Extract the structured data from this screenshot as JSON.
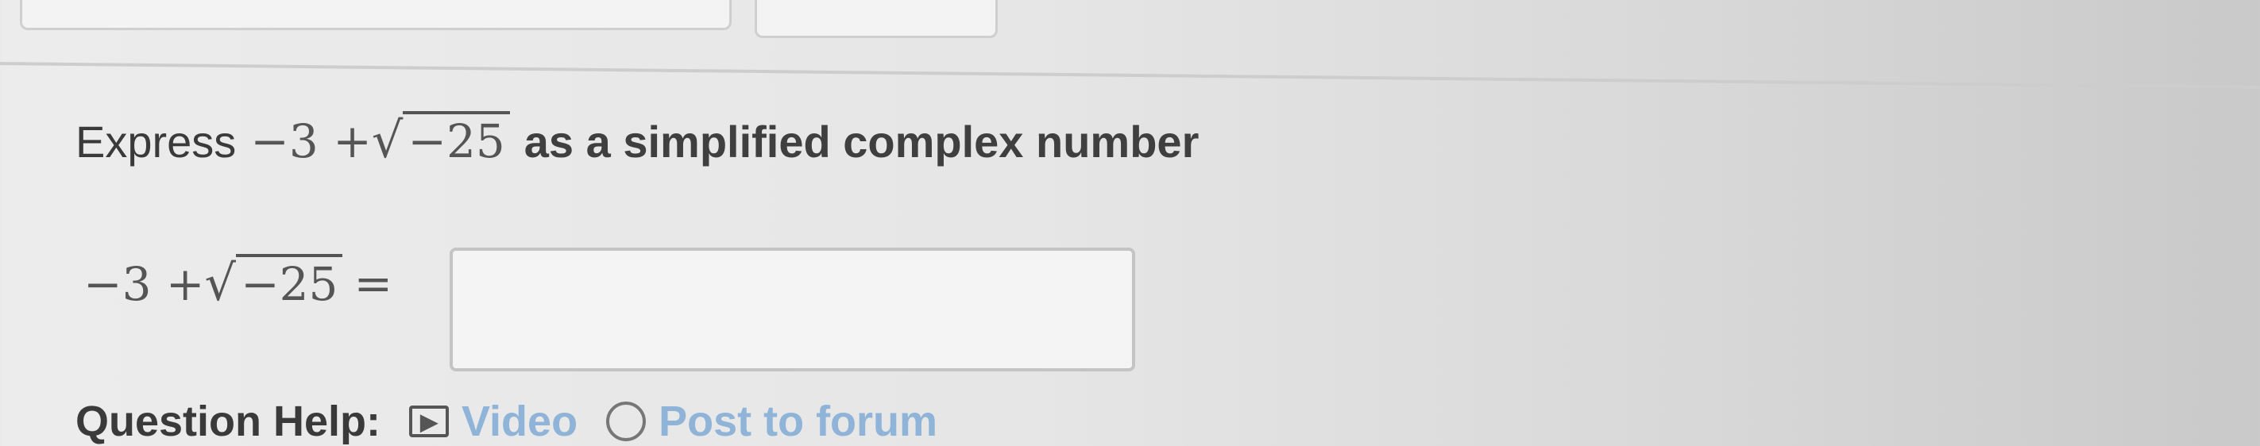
{
  "question": {
    "prefix": "Express",
    "expression": {
      "lead": "−3 + ",
      "radicand": "−25"
    },
    "suffix": "as a simplified complex number"
  },
  "answer_row": {
    "expression": {
      "lead": "−3 + ",
      "radicand": "−25"
    },
    "equals": "=",
    "input_value": ""
  },
  "help": {
    "label": "Question Help:",
    "video_label": "Video",
    "forum_label": "Post to forum"
  }
}
